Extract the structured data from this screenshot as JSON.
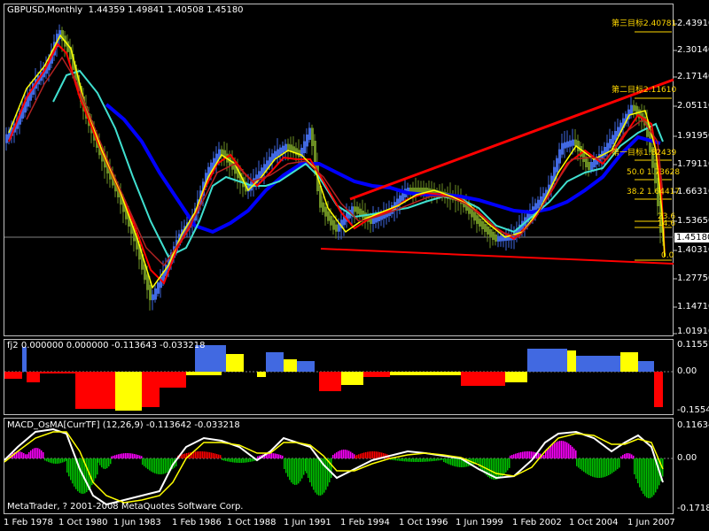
{
  "main_panel": {
    "symbol": "GBPUSD,Monthly",
    "ohlc": "1.44359 1.49841 1.40508 1.45180",
    "current_price": "1.45180",
    "y_ticks": [
      "2.43910",
      "2.30140",
      "2.17140",
      "2.05110",
      "1.91950",
      "1.79110",
      "1.66310",
      "1.53650",
      "1.40310",
      "1.27750",
      "1.14710",
      "1.01910"
    ],
    "fib_labels": [
      "第三目标2.40781",
      "第二目标2.11610",
      "第一目标1.82439",
      "50.0 1.73628",
      "38.2 1.64417",
      "23.6",
      "14.6",
      "0.0"
    ]
  },
  "fj2_panel": {
    "title": "fj2 0.000000 0.000000 -0.113643 -0.033218",
    "y_ticks": [
      "0.115571",
      "0.00",
      "-0.155481"
    ]
  },
  "macd_panel": {
    "title": "MACD_OsMA[CurrTF] (12,26,9) -0.113642 -0.033218",
    "y_ticks": [
      "0.116346",
      "0.00",
      "-0.171801"
    ]
  },
  "x_axis": {
    "labels": [
      "1 Feb 1978",
      "1 Oct 1980",
      "1 Jun 1983",
      "1 Feb 1986",
      "1 Oct 1988",
      "1 Jun 1991",
      "1 Feb 1994",
      "1 Oct 1996",
      "1 Jun 1999",
      "1 Feb 2002",
      "1 Oct 2004",
      "1 Jun 2007"
    ]
  },
  "copyright": "MetaTrader, ? 2001-2008 MetaQuotes Software Corp.",
  "colors": {
    "bull_candle": "#4169e1",
    "bear_candle": "#6b8e23",
    "ma_red": "#ff0000",
    "ma_yellow": "#ffff00",
    "ma_cyan": "#40e0d0",
    "ma_blue": "#0000ff",
    "hist_blue": "#4169e1",
    "hist_red": "#ff0000",
    "hist_yellow": "#ffff00",
    "osma_green": "#00c000",
    "osma_magenta": "#ff00ff"
  }
}
